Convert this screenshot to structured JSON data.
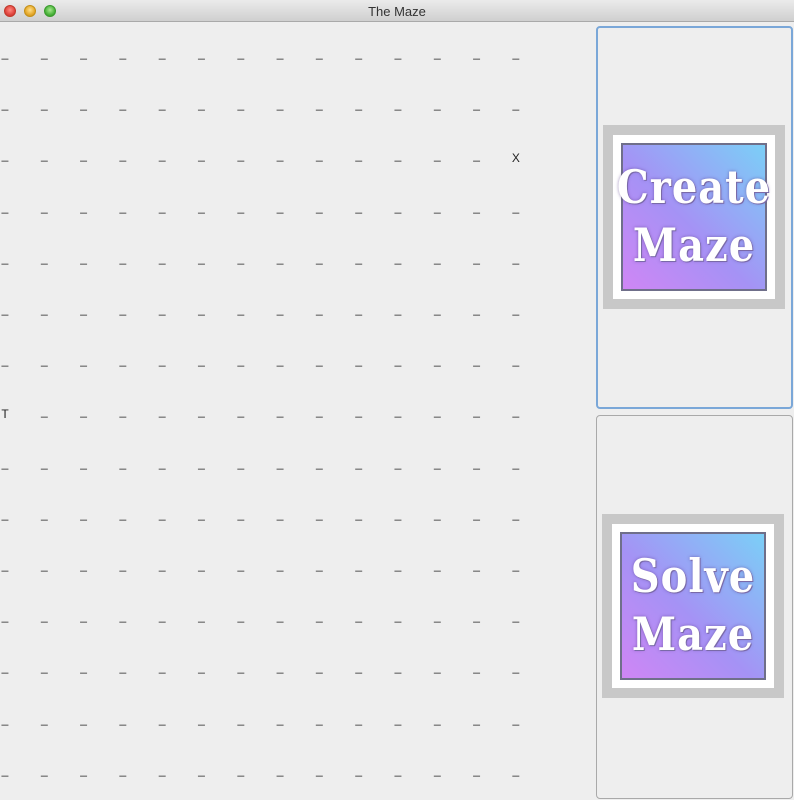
{
  "window": {
    "title": "The Maze"
  },
  "maze": {
    "rows": 15,
    "cols": 14,
    "empty_cell": "_",
    "marks": [
      {
        "row": 2,
        "col": 13,
        "symbol": "X"
      },
      {
        "row": 7,
        "col": 0,
        "symbol": "T"
      }
    ]
  },
  "buttons": {
    "create": {
      "line1": "Create",
      "line2": "Maze"
    },
    "solve": {
      "line1": "Solve",
      "line2": "Maze"
    }
  },
  "colors": {
    "gradient_start": "#cf86f5",
    "gradient_end": "#7bcff7",
    "focus_border": "#7aa7d8"
  }
}
